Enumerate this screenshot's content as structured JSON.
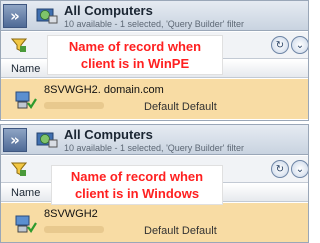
{
  "panels": [
    {
      "header": {
        "title": "All Computers",
        "subtitle": "10 available - 1 selected, 'Query Builder' filter"
      },
      "column": {
        "name": "Name"
      },
      "callout": "Name of record when client is in WinPE",
      "row": {
        "name": "8SVWGH2. domain.com",
        "default_text": "Default Default"
      }
    },
    {
      "header": {
        "title": "All Computers",
        "subtitle": "10 available - 1 selected, 'Query Builder' filter"
      },
      "column": {
        "name": "Name"
      },
      "callout": "Name of record when client is in Windows",
      "row": {
        "name": "8SVWGH2",
        "default_text": "Default Default"
      }
    }
  ],
  "icons": {
    "expand": "double-chevron-right-icon",
    "collection": "globe-computer-icon",
    "filter": "filter-icon",
    "refresh": "refresh-icon",
    "collapse": "chevron-down-icon",
    "row": "computer-icon"
  },
  "colors": {
    "selected_row": "#f8dca4",
    "callout_text": "#ff2020",
    "header_bg": "#c9d3e0"
  }
}
